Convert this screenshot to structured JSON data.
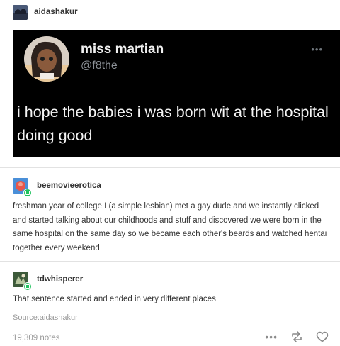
{
  "post": {
    "reblogger": "aidashakur",
    "tweet": {
      "display_name": "miss martian",
      "handle": "@f8the",
      "more_icon": "ellipsis-icon",
      "text": "i hope the babies i was born wit at the hospital doing good"
    }
  },
  "reblogs": [
    {
      "username": "beemovieerotica",
      "text": "freshman year of college I (a simple lesbian) met a gay dude and we instantly clicked and started talking about our childhoods and stuff and discovered we were born in the same hospital on the same day so we became each other's beards and watched hentai together every weekend"
    },
    {
      "username": "tdwhisperer",
      "text": "That sentence started and ended in very different places"
    }
  ],
  "source": {
    "label": "Source:",
    "name": "aidashakur"
  },
  "footer": {
    "notes": "19,309 notes",
    "icons": [
      "more-icon",
      "reblog-icon",
      "heart-icon"
    ]
  },
  "colors": {
    "tweet_bg": "#000000",
    "badge_green": "#21c25e",
    "muted_text": "#9a9a9a"
  }
}
